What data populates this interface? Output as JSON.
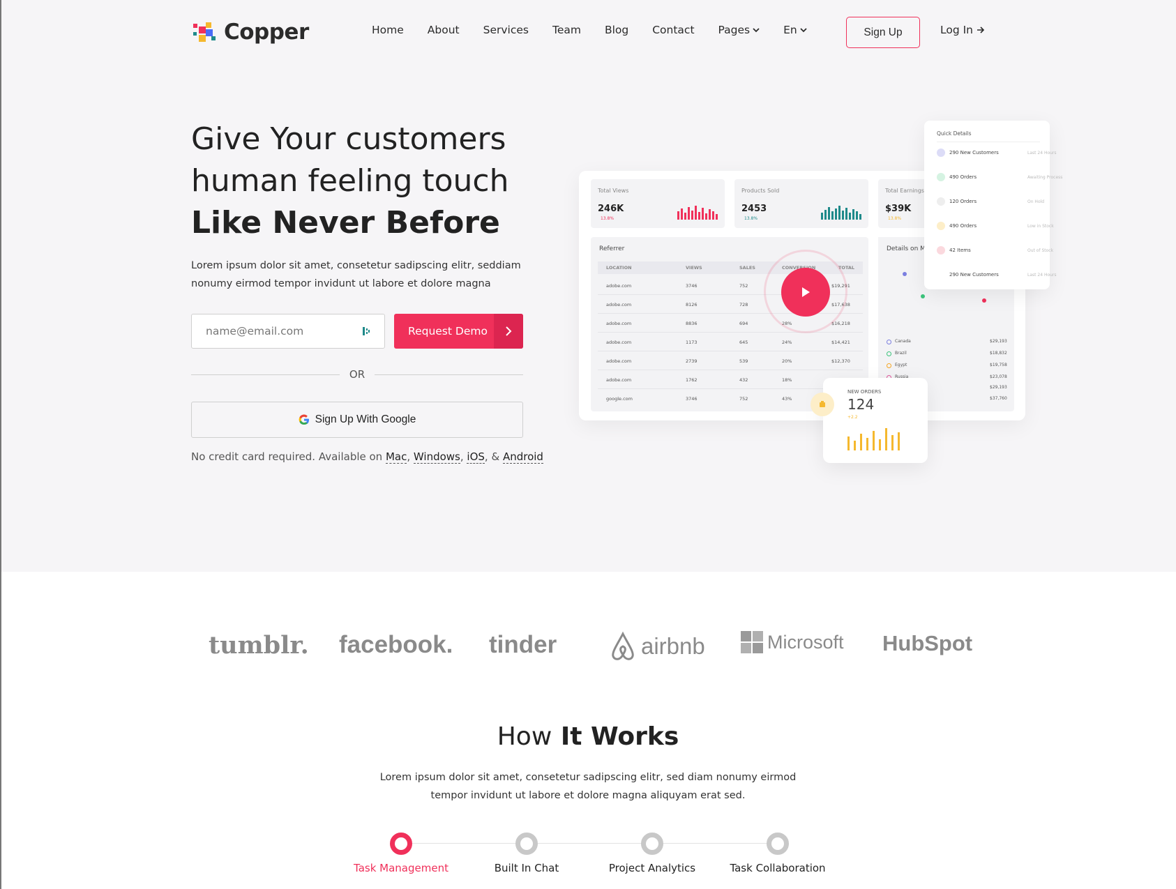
{
  "brand": {
    "name": "Copper"
  },
  "nav": {
    "items": [
      "Home",
      "About",
      "Services",
      "Team",
      "Blog",
      "Contact",
      "Pages",
      "En"
    ],
    "signup": "Sign Up",
    "login": "Log In"
  },
  "hero": {
    "line1": "Give Your customers",
    "line2": "human feeling touch",
    "line3": "Like Never Before",
    "lead": "Lorem ipsum dolor sit amet, consetetur sadipscing elitr, seddiam nonumy eirmod tempor invidunt ut labore et dolore magna",
    "email_placeholder": "name@email.com",
    "demo_button": "Request Demo",
    "or": "OR",
    "google_button": "Sign Up With Google",
    "note_prefix": "No credit card required. Available on",
    "platforms": [
      "Mac",
      "Windows",
      "iOS",
      "Android"
    ]
  },
  "dashboard": {
    "stats": [
      {
        "label": "Total Views",
        "value": "246K",
        "delta": "13.8%"
      },
      {
        "label": "Products Sold",
        "value": "2453",
        "delta": "13.8%"
      },
      {
        "label": "Total Earnings",
        "value": "$39K",
        "delta": "13.8%"
      }
    ],
    "referrer": {
      "title": "Referrer",
      "headers": [
        "LOCATION",
        "VIEWS",
        "SALES",
        "CONVERSION",
        "TOTAL"
      ],
      "rows": [
        [
          "adobe.com",
          "3746",
          "752",
          "",
          "$19,291"
        ],
        [
          "adobe.com",
          "8126",
          "728",
          "",
          "$17,638"
        ],
        [
          "adobe.com",
          "8836",
          "694",
          "28%",
          "$16,218"
        ],
        [
          "adobe.com",
          "1173",
          "645",
          "24%",
          "$14,421"
        ],
        [
          "adobe.com",
          "2739",
          "539",
          "20%",
          "$12,370"
        ],
        [
          "adobe.com",
          "1762",
          "432",
          "18%",
          ""
        ],
        [
          "google.com",
          "3746",
          "752",
          "43%",
          ""
        ]
      ]
    },
    "details": {
      "title": "Details on M",
      "countries": [
        {
          "name": "Canada",
          "value": "$29,193",
          "color": "#7b7fe0"
        },
        {
          "name": "Brazil",
          "value": "$18,832",
          "color": "#3cc47c"
        },
        {
          "name": "Egypt",
          "value": "$19,758",
          "color": "#f5a623"
        },
        {
          "name": "Russia",
          "value": "$23,078",
          "color": "#e0559a"
        }
      ],
      "extra_values": [
        "$29,193",
        "$37,760"
      ]
    },
    "quick_details": {
      "title": "Quick Details",
      "rows": [
        {
          "text": "290 New Customers",
          "status": "Last 24 Hours",
          "color": "#dcdcf7"
        },
        {
          "text": "490 Orders",
          "status": "Awaiting Process",
          "color": "#d5f3e2"
        },
        {
          "text": "120 Orders",
          "status": "On Hold",
          "color": "#eeeeee"
        },
        {
          "text": "490 Orders",
          "status": "Low in Stock",
          "color": "#fdeec8"
        },
        {
          "text": "42 Items",
          "status": "Out of Stock",
          "color": "#fbd9de"
        },
        {
          "text": "290 New Customers",
          "status": "Last 24 Hours",
          "color": "#ffffff"
        }
      ]
    },
    "new_orders": {
      "label": "NEW ORDERS",
      "value": "124",
      "delta": "+2.2"
    }
  },
  "partners": [
    "tumblr.",
    "facebook.",
    "tinder",
    "airbnb",
    "Microsoft",
    "HubSpot"
  ],
  "how": {
    "title_light": "How",
    "title_bold": "It Works",
    "lead": "Lorem ipsum dolor sit amet, consetetur sadipscing elitr, sed diam nonumy eirmod tempor invidunt ut labore et dolore magna aliquyam erat sed.",
    "steps": [
      "Task Management",
      "Built In Chat",
      "Project Analytics",
      "Task Collaboration"
    ]
  },
  "colors": {
    "accent": "#f0305a",
    "teal": "#1f8a8a",
    "gold": "#f5b82e",
    "hero_bg": "#f6f5f7"
  }
}
